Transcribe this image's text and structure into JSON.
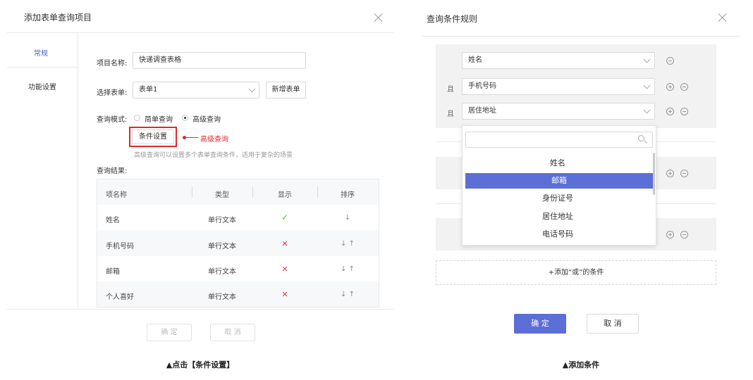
{
  "left": {
    "title": "添加表单查询项目",
    "side_nav": [
      {
        "label": "常规"
      },
      {
        "label": "功能设置"
      }
    ],
    "form": {
      "project_name_label": "项目名称:",
      "project_name_value": "快递调查表格",
      "select_form_label": "选择表单:",
      "select_form_value": "表单1",
      "new_form_button": "新增表单",
      "query_mode_label": "查询模式:",
      "mode_options": [
        {
          "label": "简单查询",
          "selected": false
        },
        {
          "label": "高级查询",
          "selected": true
        }
      ],
      "condition_button": "条件设置",
      "callout_label": "高级查询",
      "hint": "高级查询可以设置多个表单查询条件，适用于复杂的场景",
      "result_label": "查询结果:"
    },
    "table": {
      "columns": [
        "项名称",
        "类型",
        "显示",
        "排序"
      ],
      "rows": [
        {
          "name": "姓名",
          "type": "单行文本",
          "show": "✓",
          "sort": "↓"
        },
        {
          "name": "手机号码",
          "type": "单行文本",
          "show": "✕",
          "sort": "↓ ↑"
        },
        {
          "name": "邮箱",
          "type": "单行文本",
          "show": "✕",
          "sort": "↓ ↑"
        },
        {
          "name": "个人喜好",
          "type": "单行文本",
          "show": "✕",
          "sort": "↓ ↑"
        }
      ]
    },
    "ok_button": "确 定",
    "cancel_button": "取 消",
    "caption": "▲点击【条件设置】"
  },
  "right": {
    "title": "查询条件规则",
    "and_label": "且",
    "conditions": [
      {
        "value": "姓名"
      },
      {
        "value": "手机号码"
      },
      {
        "value": "居住地址"
      }
    ],
    "dropdown": {
      "search_placeholder": "",
      "options": [
        {
          "label": "姓名",
          "active": false
        },
        {
          "label": "邮箱",
          "active": true
        },
        {
          "label": "身份证号",
          "active": false
        },
        {
          "label": "居住地址",
          "active": false
        },
        {
          "label": "电话号码",
          "active": false
        }
      ]
    },
    "add_or_condition": "+添加“或”的条件",
    "ok_button": "确 定",
    "cancel_button": "取 消",
    "caption": "▲添加条件"
  },
  "colors": {
    "accent": "#5b6fd6",
    "highlight": "#e0282e",
    "check": "#52c41a",
    "cross": "#e8353b"
  }
}
